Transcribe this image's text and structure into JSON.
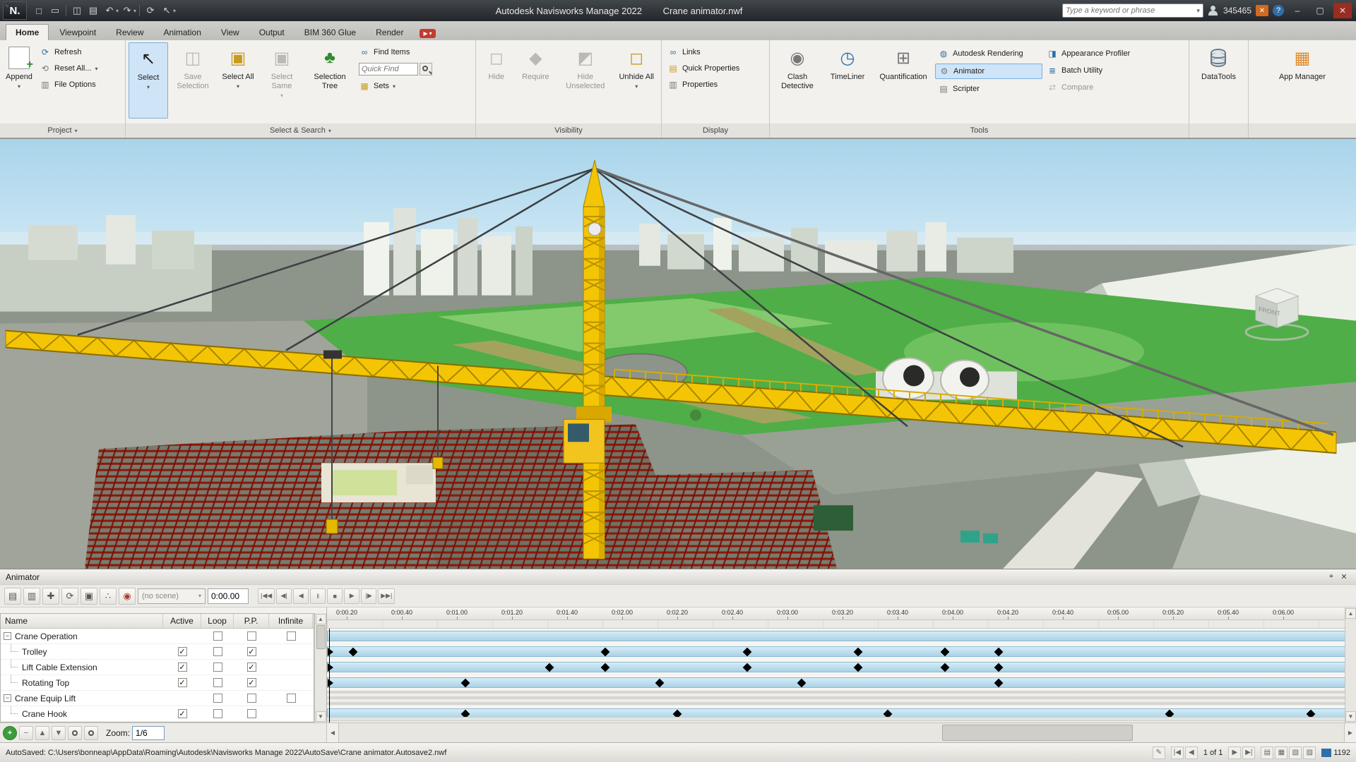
{
  "colors": {
    "accent_blue": "#cfe4f7",
    "highlight_border": "#7ab0dd",
    "crane_yellow": "#f3c504",
    "sky_blue": "#aed6ec",
    "grass_green": "#4fae47",
    "steel_red": "#8e1808"
  },
  "icons": {
    "new-file": "□",
    "open-folder": "▭",
    "save": "◫",
    "print": "▤",
    "undo": "↶",
    "redo": "↷",
    "refresh": "⟳",
    "select-cursor": "↖",
    "dropdown": "▾",
    "file-options": "▥",
    "reset-all": "⟲",
    "selection-tree": "♣",
    "find-items": "∞",
    "sets": "▦",
    "hide": "◻",
    "require": "◆",
    "hide-unselected": "◩",
    "unhide-all": "◻",
    "links": "∞",
    "quick-properties": "▤",
    "properties": "▥",
    "clash": "◉",
    "timeliner": "◷",
    "quantification": "⊞",
    "rendering": "◍",
    "animator": "⚙",
    "scripter": "▤",
    "appearance": "◨",
    "batch": "≣",
    "compare": "⇄",
    "appmanager": "▦",
    "pin": "⌖",
    "close": "✕",
    "minimize": "–",
    "maximize": "▢",
    "help": "?",
    "cart": "✕",
    "add-scene": "▤",
    "update-scene": "▥",
    "translate-set": "✚",
    "rotate-set": "⟳",
    "scale-set": "▣",
    "snapping": "∴",
    "capture-keyframe": "◉",
    "up": "▲",
    "down": "▼",
    "left": "◀",
    "right": "▶",
    "add": "+",
    "remove": "−",
    "zoom-in": "+",
    "zoom-out": "−",
    "edit": "✎",
    "sheet1": "▤",
    "sheet2": "▦",
    "sheet3": "▧",
    "sheet4": "▨",
    "first": "|◀",
    "prev": "◀",
    "next": "▶",
    "last": "▶|"
  },
  "title_bar": {
    "app_title": "Autodesk Navisworks Manage 2022",
    "doc_title": "Crane animator.nwf",
    "search_placeholder": "Type a keyword or phrase",
    "user_id": "345465"
  },
  "ribbon": {
    "tabs": [
      "Home",
      "Viewpoint",
      "Review",
      "Animation",
      "View",
      "Output",
      "BIM 360 Glue",
      "Render"
    ],
    "active_tab": "Home",
    "project": {
      "label": "Project",
      "append": "Append",
      "refresh": "Refresh",
      "reset_all": "Reset All...",
      "file_options": "File Options"
    },
    "select_search": {
      "label": "Select & Search",
      "select": "Select",
      "save_selection": "Save Selection",
      "select_all": "Select All",
      "select_same": "Select Same",
      "selection_tree": "Selection Tree",
      "find_items": "Find Items",
      "quick_find_placeholder": "Quick Find",
      "sets": "Sets"
    },
    "visibility": {
      "label": "Visibility",
      "hide": "Hide",
      "require": "Require",
      "hide_unselected": "Hide Unselected",
      "unhide_all": "Unhide All"
    },
    "display": {
      "label": "Display",
      "links": "Links",
      "quick_properties": "Quick Properties",
      "properties": "Properties"
    },
    "tools": {
      "label": "Tools",
      "clash_detective": "Clash Detective",
      "timeliner": "TimeLiner",
      "quantification": "Quantification",
      "autodesk_rendering": "Autodesk Rendering",
      "animator": "Animator",
      "scripter": "Scripter",
      "appearance_profiler": "Appearance Profiler",
      "batch_utility": "Batch Utility",
      "compare": "Compare"
    },
    "datatools": {
      "label": "DataTools"
    },
    "app_manager": {
      "label": "App Manager"
    }
  },
  "viewport": {
    "view_cube_label": "FRONT"
  },
  "animator": {
    "panel_title": "Animator",
    "toolbar_icons": [
      "add-scene",
      "update-scene",
      "translate-set",
      "rotate-set",
      "scale-set",
      "snapping",
      "capture-keyframe"
    ],
    "scene_selector": "(no scene)",
    "time_display": "0:00.00",
    "playback": [
      [
        "rewind-button",
        "|◀◀"
      ],
      [
        "step-back-button",
        "◀|"
      ],
      [
        "play-reverse-button",
        "◀"
      ],
      [
        "pause-button",
        "‖"
      ],
      [
        "stop-button",
        "■"
      ],
      [
        "play-button",
        "▶"
      ],
      [
        "step-forward-button",
        "|▶"
      ],
      [
        "fast-forward-button",
        "▶▶|"
      ]
    ],
    "columns": [
      "Name",
      "Active",
      "Loop",
      "P.P.",
      "Infinite"
    ],
    "rows": [
      {
        "name": "Crane Operation",
        "level": 0,
        "active": null,
        "loop": false,
        "pp": false,
        "infinite": false
      },
      {
        "name": "Trolley",
        "level": 1,
        "active": true,
        "loop": false,
        "pp": true,
        "infinite": null
      },
      {
        "name": "Lift Cable Extension",
        "level": 1,
        "active": true,
        "loop": false,
        "pp": true,
        "infinite": null
      },
      {
        "name": "Rotating Top",
        "level": 1,
        "active": true,
        "loop": false,
        "pp": true,
        "infinite": null
      },
      {
        "name": "Crane Equip Lift",
        "level": 0,
        "active": null,
        "loop": false,
        "pp": false,
        "infinite": false
      },
      {
        "name": "Crane Hook",
        "level": 1,
        "active": true,
        "loop": false,
        "pp": false,
        "infinite": null
      }
    ],
    "zoom_label": "Zoom:",
    "zoom_value": "1/6",
    "timeline": {
      "ticks": [
        "0:00.20",
        "0:00.40",
        "0:01.00",
        "0:01.20",
        "0:01.40",
        "0:02.00",
        "0:02.20",
        "0:02.40",
        "0:03.00",
        "0:03.20",
        "0:03.40",
        "0:04.00",
        "0:04.20",
        "0:04.40",
        "0:05.00",
        "0:05.20",
        "0:05.40",
        "0:06.00"
      ],
      "rows": [
        {
          "name": "Crane Operation",
          "type": "bar",
          "start_marker": false,
          "keyframes_pct": []
        },
        {
          "name": "Trolley",
          "type": "bar",
          "start_marker": true,
          "keyframes_pct": [
            2.5,
            27.0,
            40.8,
            51.6,
            60.1,
            65.3
          ]
        },
        {
          "name": "Lift Cable Extension",
          "type": "bar",
          "start_marker": true,
          "keyframes_pct": [
            21.6,
            27.0,
            40.8,
            51.6,
            60.1,
            65.3
          ]
        },
        {
          "name": "Rotating Top",
          "type": "bar",
          "start_marker": true,
          "keyframes_pct": [
            13.4,
            32.3,
            46.1,
            65.3
          ]
        },
        {
          "name": "Crane Equip Lift",
          "type": "striped",
          "start_marker": false,
          "keyframes_pct": []
        },
        {
          "name": "Crane Hook",
          "type": "bar",
          "start_marker": false,
          "keyframes_pct": [
            13.4,
            34.0,
            54.5,
            81.9,
            95.7
          ]
        }
      ]
    }
  },
  "status_bar": {
    "autosave_text": "AutoSaved: C:\\Users\\bonneap\\AppData\\Roaming\\Autodesk\\Navisworks Manage 2022\\AutoSave\\Crane animator.Autosave2.nwf",
    "page_indicator": "1 of 1",
    "memory_value": "1192"
  }
}
